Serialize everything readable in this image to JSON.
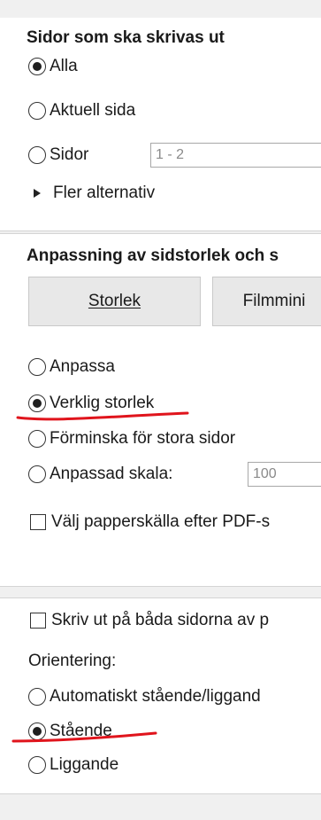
{
  "pages_section": {
    "heading": "Sidor som ska skrivas ut",
    "options": [
      {
        "label": "Alla",
        "checked": true
      },
      {
        "label": "Aktuell sida",
        "checked": false
      },
      {
        "label": "Sidor",
        "checked": false
      }
    ],
    "pages_field_value": "1 - 2",
    "more_options": "Fler alternativ"
  },
  "scaling_section": {
    "heading": "Anpassning av sidstorlek och s",
    "buttons": [
      "Storlek",
      "Filmmini"
    ],
    "options": [
      {
        "label": "Anpassa",
        "checked": false
      },
      {
        "label": "Verklig storlek",
        "checked": true
      },
      {
        "label": "Förminska för stora sidor",
        "checked": false
      },
      {
        "label": "Anpassad skala:",
        "checked": false
      }
    ],
    "scale_field_value": "100",
    "paper_source_checkbox": "Välj papperskälla efter PDF-s"
  },
  "duplex_section": {
    "duplex_checkbox": "Skriv ut på båda sidorna av p",
    "orientation_label": "Orientering:",
    "options": [
      {
        "label": "Automatiskt stående/liggand",
        "checked": false
      },
      {
        "label": "Stående",
        "checked": true
      },
      {
        "label": "Liggande",
        "checked": false
      }
    ]
  },
  "colors": {
    "annotation": "#e0141c"
  }
}
